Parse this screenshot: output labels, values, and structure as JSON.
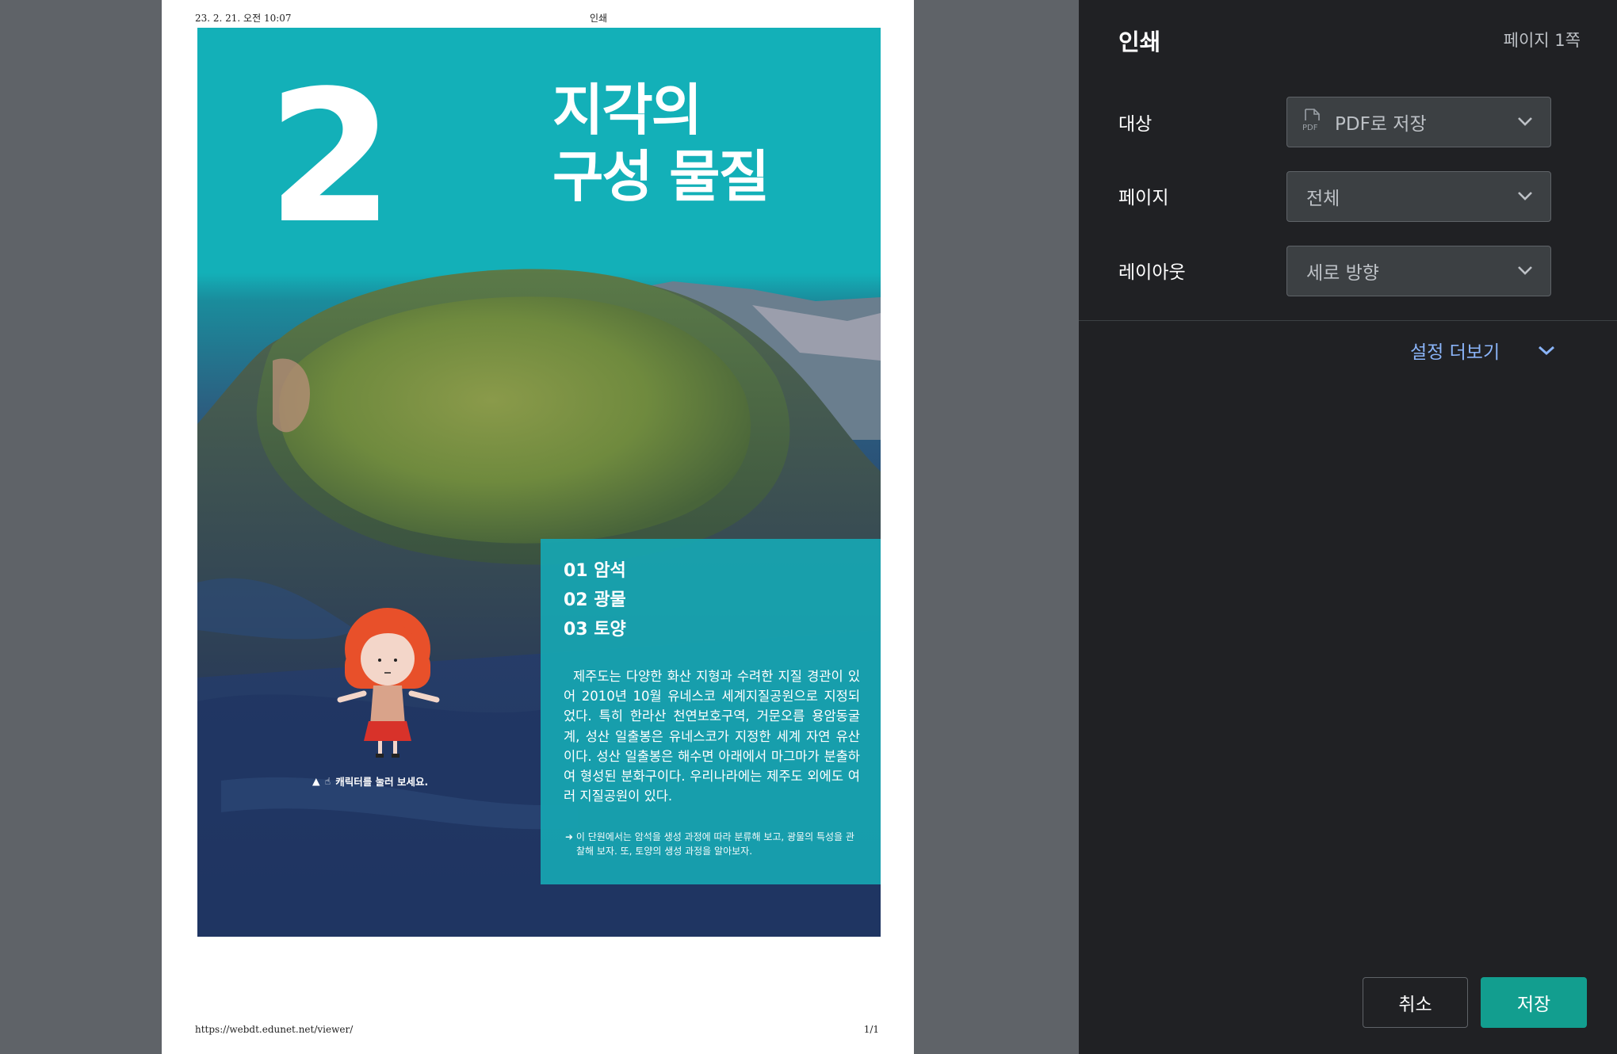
{
  "preview": {
    "header_date": "23. 2. 21. 오전 10:07",
    "header_title": "인쇄",
    "footer_url": "https://webdt.edunet.net/viewer/",
    "footer_page": "1/1",
    "cover": {
      "chapter_number": "2",
      "title_line1": "지각의",
      "title_line2": "구성 물질",
      "toc": [
        "01  암석",
        "02  광물",
        "03  토양"
      ],
      "intro": "제주도는 다양한 화산 지형과 수려한 지질 경관이 있어 2010년 10월 유네스코 세계지질공원으로 지정되었다. 특히 한라산 천연보호구역, 거문오름 용암동굴계, 성산 일출봉은 유네스코가 지정한 세계 자연 유산이다. 성산 일출봉은 해수면 아래에서 마그마가 분출하여 형성된 분화구이다. 우리나라에는 제주도 외에도 여러 지질공원이 있다.",
      "note": "➜ 이 단원에서는 암석을 생성 과정에 따라 분류해 보고, 광물의 특성을 관찰해 보자. 또, 토양의 생성 과정을 알아보자.",
      "character_caption": "캐릭터를 눌러 보세요."
    }
  },
  "panel": {
    "title": "인쇄",
    "page_count": "페이지 1쪽",
    "destination_label": "대상",
    "destination_value": "PDF로 저장",
    "pages_label": "페이지",
    "pages_value": "전체",
    "layout_label": "레이아웃",
    "layout_value": "세로 방향",
    "more_settings": "설정 더보기",
    "cancel_label": "취소",
    "save_label": "저장",
    "accent_color": "#129e8f",
    "link_color": "#8ab4f8"
  }
}
